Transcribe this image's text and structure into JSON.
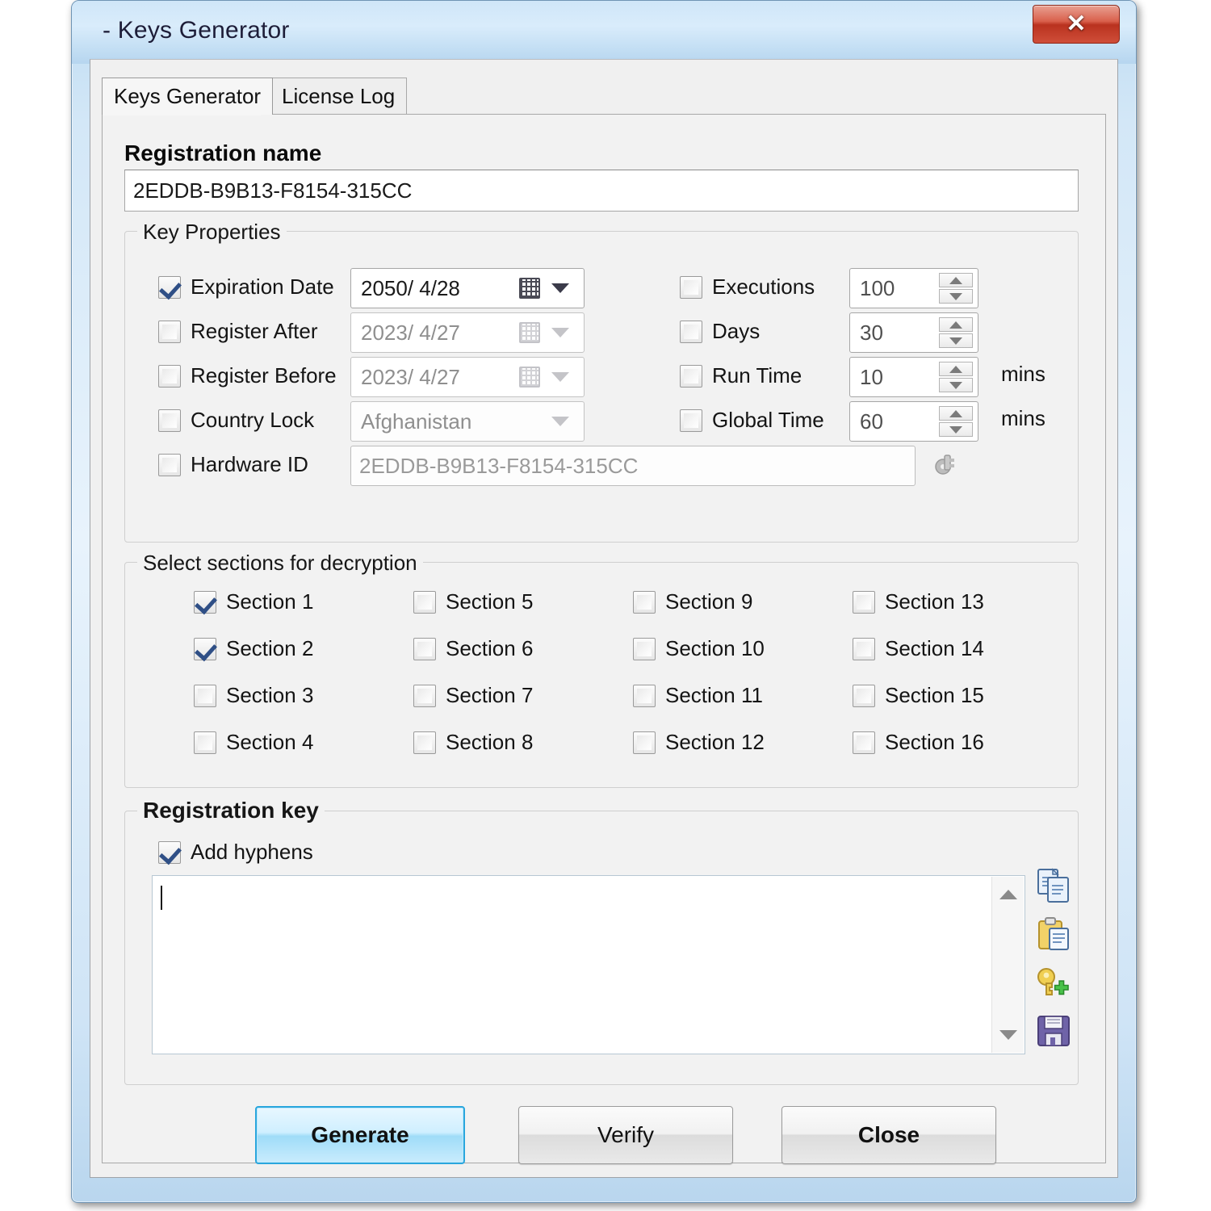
{
  "window": {
    "title": "- Keys Generator",
    "close_label": "✕"
  },
  "tabs": [
    {
      "label": "Keys Generator",
      "active": true
    },
    {
      "label": "License Log",
      "active": false
    }
  ],
  "registration_name": {
    "header": "Registration name",
    "value": "2EDDB-B9B13-F8154-315CC"
  },
  "key_properties": {
    "title": "Key Properties",
    "left_rows": [
      {
        "label": "Expiration Date",
        "checked": true,
        "value": "2050/  4/28"
      },
      {
        "label": "Register After",
        "checked": false,
        "value": "2023/  4/27"
      },
      {
        "label": "Register Before",
        "checked": false,
        "value": "2023/  4/27"
      },
      {
        "label": "Country Lock",
        "checked": false,
        "value": "Afghanistan"
      },
      {
        "label": "Hardware ID",
        "checked": false,
        "value": "2EDDB-B9B13-F8154-315CC"
      }
    ],
    "right_rows": [
      {
        "label": "Executions",
        "checked": false,
        "value": "100",
        "unit": ""
      },
      {
        "label": "Days",
        "checked": false,
        "value": "30",
        "unit": ""
      },
      {
        "label": "Run Time",
        "checked": false,
        "value": "10",
        "unit": "mins"
      },
      {
        "label": "Global Time",
        "checked": false,
        "value": "60",
        "unit": "mins"
      }
    ]
  },
  "sections": {
    "title": "Select sections for decryption",
    "items": [
      {
        "label": "Section 1",
        "checked": true
      },
      {
        "label": "Section 2",
        "checked": true
      },
      {
        "label": "Section 3",
        "checked": false
      },
      {
        "label": "Section 4",
        "checked": false
      },
      {
        "label": "Section 5",
        "checked": false
      },
      {
        "label": "Section 6",
        "checked": false
      },
      {
        "label": "Section 7",
        "checked": false
      },
      {
        "label": "Section 8",
        "checked": false
      },
      {
        "label": "Section 9",
        "checked": false
      },
      {
        "label": "Section 10",
        "checked": false
      },
      {
        "label": "Section 11",
        "checked": false
      },
      {
        "label": "Section 12",
        "checked": false
      },
      {
        "label": "Section 13",
        "checked": false
      },
      {
        "label": "Section 14",
        "checked": false
      },
      {
        "label": "Section 15",
        "checked": false
      },
      {
        "label": "Section 16",
        "checked": false
      }
    ]
  },
  "registration_key": {
    "title": "Registration key",
    "add_hyphens_label": "Add hyphens",
    "add_hyphens_checked": true,
    "value": "",
    "side_actions": [
      {
        "name": "copy-icon"
      },
      {
        "name": "paste-icon"
      },
      {
        "name": "add-key-icon"
      },
      {
        "name": "save-icon"
      }
    ]
  },
  "buttons": {
    "generate": "Generate",
    "verify": "Verify",
    "close": "Close"
  },
  "colors": {
    "accent": "#29a6dd",
    "close_red": "#b9321f",
    "check": "#2f4f86"
  }
}
